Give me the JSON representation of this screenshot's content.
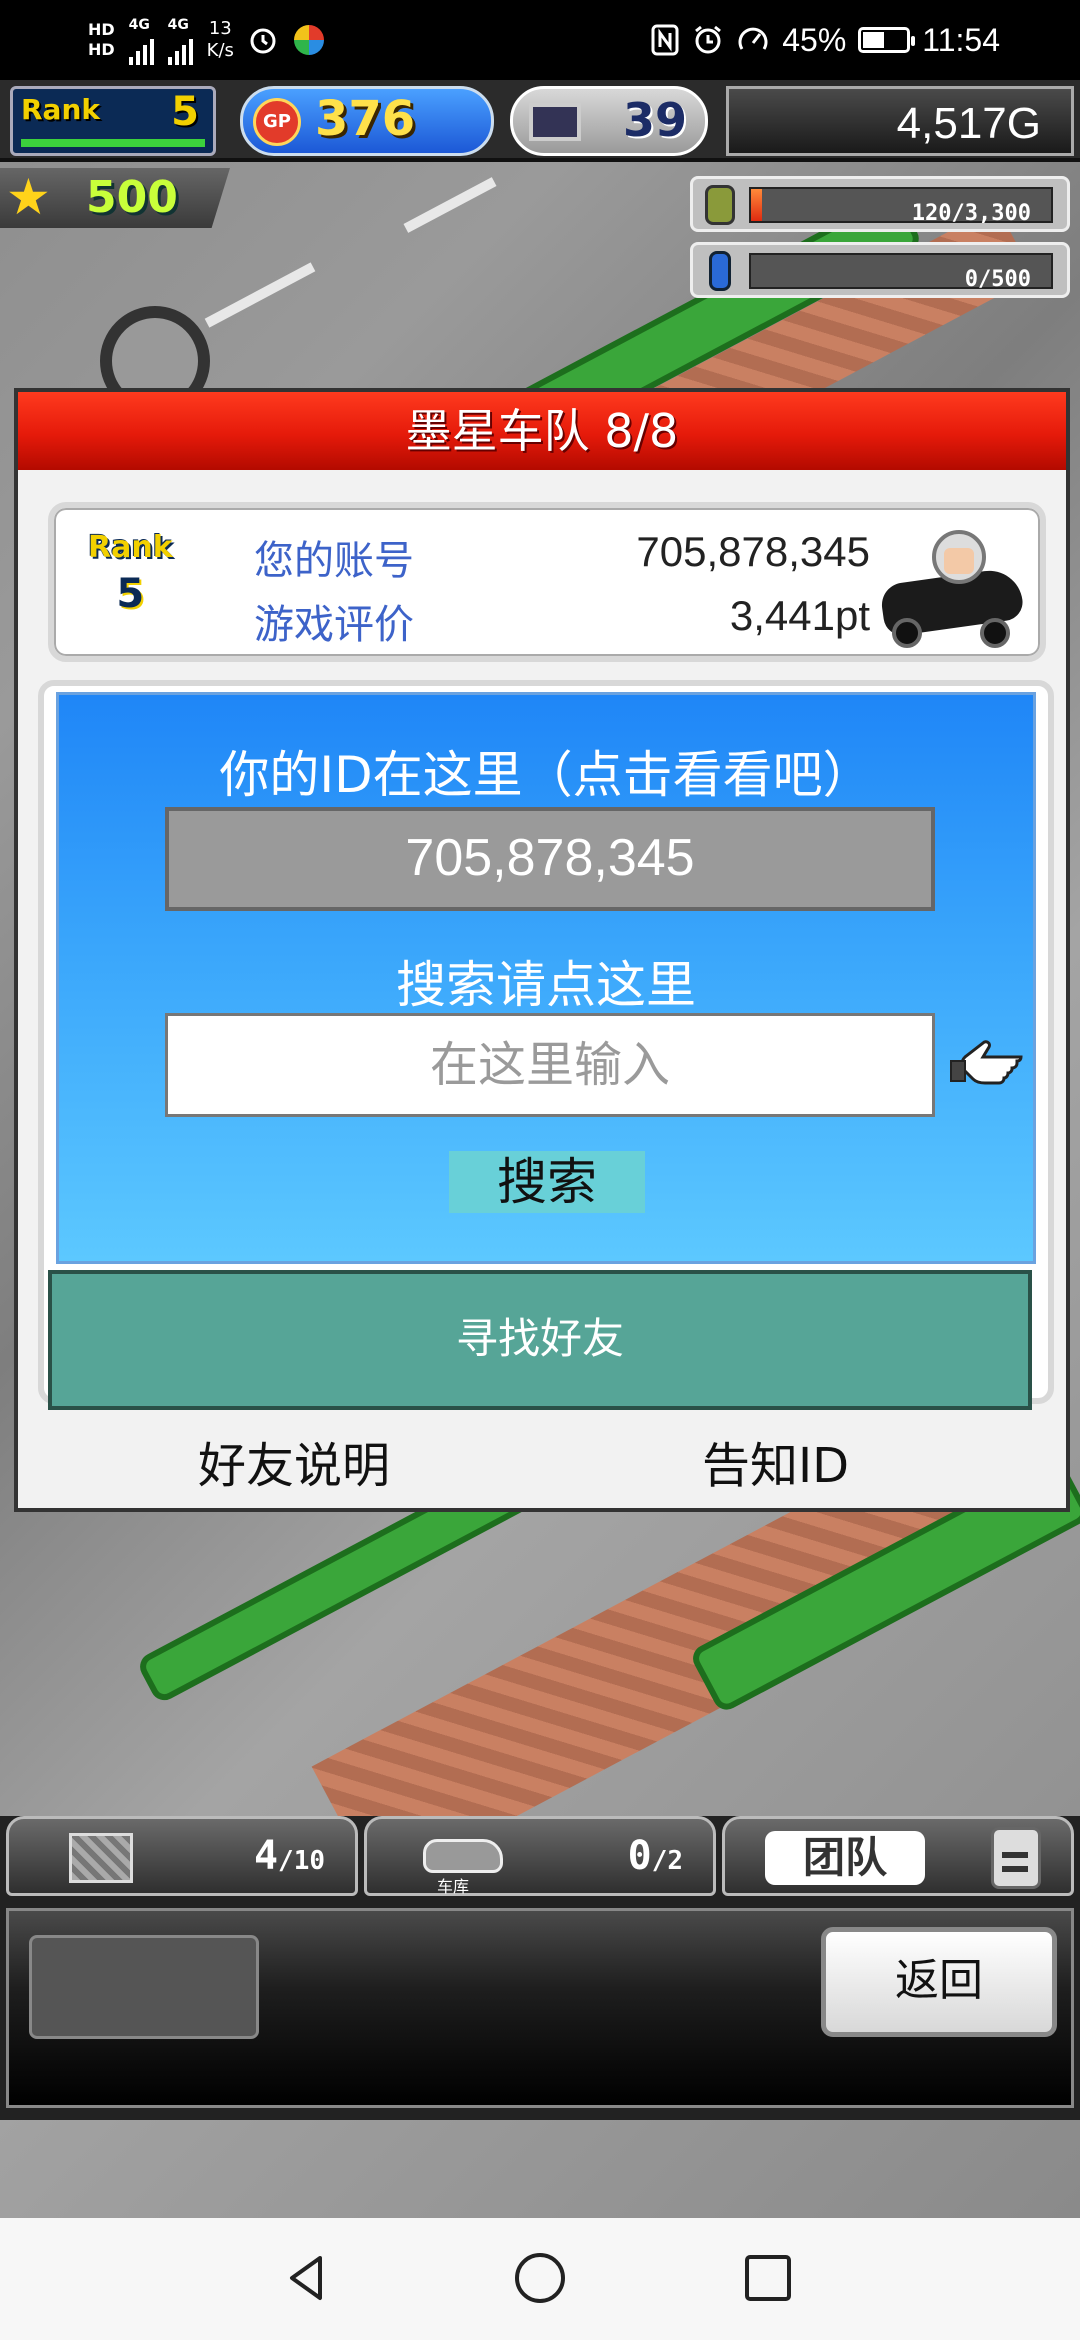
{
  "status_bar": {
    "network_1": "HD",
    "network_2": "HD",
    "signal_1": "4G",
    "signal_2": "4G",
    "speed_value": "13",
    "speed_unit": "K/s",
    "battery": "45%",
    "time": "11:54"
  },
  "hud": {
    "rank_label": "Rank",
    "rank_value": "5",
    "gp_label": "GP",
    "gp_value": "376",
    "pc_value": "39",
    "money": "4,517G",
    "star_value": "500",
    "fuel_text": "120/3,300",
    "fuel_fill_fraction": 0.036,
    "water_text": "0/500",
    "water_fill_fraction": 0
  },
  "dialog": {
    "title": "墨星车队 8/8",
    "account": {
      "rank_label": "Rank",
      "rank_value": "5",
      "id_label": "您的账号",
      "id_value": "705,878,345",
      "rating_label": "游戏评价",
      "rating_value": "3,441pt"
    },
    "id_section_title": "你的ID在这里（点击看看吧）",
    "id_display": "705,878,345",
    "search_title": "搜索请点这里",
    "search_placeholder": "在这里输入",
    "search_button": "搜索",
    "find_friends_button": "寻找好友",
    "friend_info_link": "好友说明",
    "tell_id_link": "告知ID"
  },
  "bottom_hud": {
    "tab1_count": "4",
    "tab1_max": "10",
    "tab2_label": "车库",
    "tab2_count": "0",
    "tab2_max": "2",
    "tab3_label": "团队",
    "back_button": "返回"
  },
  "colors": {
    "title_red": "#e51a0a",
    "panel_blue": "#3aa6fb",
    "find_button_teal": "#56a597",
    "search_button": "#68d0d8",
    "label_blue": "#3d63c9"
  },
  "icons": [
    "clock-icon",
    "app-icon",
    "nfc-icon",
    "alarm-icon",
    "data-saver-icon",
    "battery-icon",
    "gp-coin-icon",
    "computer-icon",
    "star-icon",
    "fuel-can-icon",
    "water-bottle-icon",
    "tire-icon",
    "car-driver-icon",
    "pointing-hand-icon",
    "crate-icon",
    "garage-car-icon",
    "staff-face-icon",
    "nav-back-icon",
    "nav-home-icon",
    "nav-recents-icon"
  ]
}
